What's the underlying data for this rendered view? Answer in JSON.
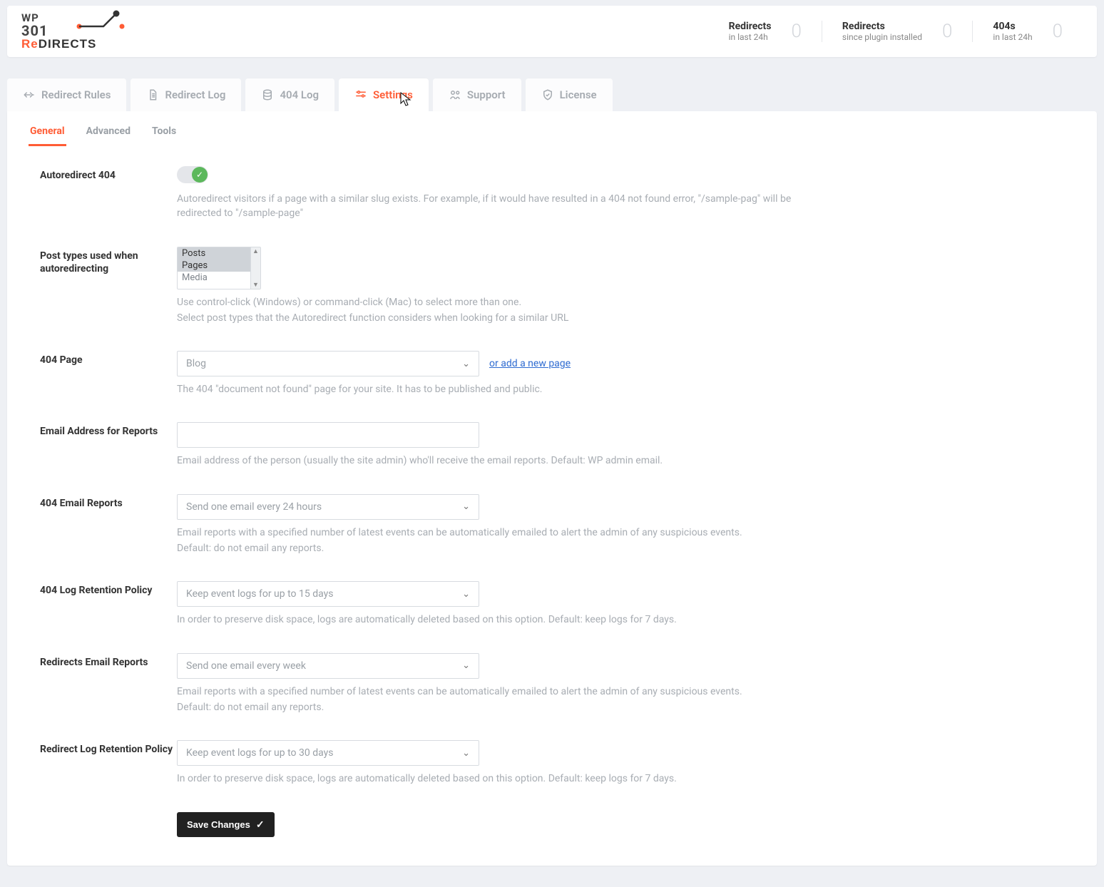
{
  "logo": {
    "wp": "WP",
    "num": "301",
    "re": "Re",
    "directs": "DIRECTS"
  },
  "stats": [
    {
      "title": "Redirects",
      "sub": "in last 24h",
      "value": "0"
    },
    {
      "title": "Redirects",
      "sub": "since plugin installed",
      "value": "0"
    },
    {
      "title": "404s",
      "sub": "in last 24h",
      "value": "0"
    }
  ],
  "tabs": {
    "redirect_rules": "Redirect Rules",
    "redirect_log": "Redirect Log",
    "log_404": "404 Log",
    "settings": "Settings",
    "support": "Support",
    "license": "License"
  },
  "subtabs": {
    "general": "General",
    "advanced": "Advanced",
    "tools": "Tools"
  },
  "fields": {
    "autoredirect": {
      "label": "Autoredirect 404",
      "help": "Autoredirect visitors if a page with a similar slug exists. For example, if it would have resulted in a 404 not found error, \"/sample-pag\" will be redirected to \"/sample-page\""
    },
    "posttypes": {
      "label": "Post types used when autoredirecting",
      "options": [
        "Posts",
        "Pages",
        "Media"
      ],
      "help1": "Use control-click (Windows) or command-click (Mac) to select more than one.",
      "help2": "Select post types that the Autoredirect function considers when looking for a similar URL"
    },
    "page404": {
      "label": "404 Page",
      "selected": "Blog",
      "link": "or add a new page",
      "help": "The 404 \"document not found\" page for your site. It has to be published and public."
    },
    "email": {
      "label": "Email Address for Reports",
      "value": "",
      "help": "Email address of the person (usually the site admin) who'll receive the email reports. Default: WP admin email."
    },
    "reports404": {
      "label": "404 Email Reports",
      "selected": "Send one email every 24 hours",
      "help1": "Email reports with a specified number of latest events can be automatically emailed to alert the admin of any suspicious events.",
      "help2": "Default: do not email any reports."
    },
    "retention404": {
      "label": "404 Log Retention Policy",
      "selected": "Keep event logs for up to 15 days",
      "help": "In order to preserve disk space, logs are automatically deleted based on this option. Default: keep logs for 7 days."
    },
    "reportsRedir": {
      "label": "Redirects Email Reports",
      "selected": "Send one email every week",
      "help1": "Email reports with a specified number of latest events can be automatically emailed to alert the admin of any suspicious events.",
      "help2": "Default: do not email any reports."
    },
    "retentionRedir": {
      "label": "Redirect Log Retention Policy",
      "selected": "Keep event logs for up to 30 days",
      "help": "In order to preserve disk space, logs are automatically deleted based on this option. Default: keep logs for 7 days."
    }
  },
  "buttons": {
    "save": "Save Changes"
  }
}
